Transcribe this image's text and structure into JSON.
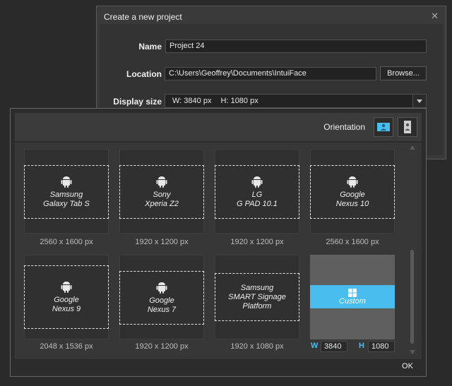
{
  "dialog": {
    "title": "Create a new project",
    "close_icon": "close-icon",
    "name_label": "Name",
    "name_value": "Project 24",
    "location_label": "Location",
    "location_value": "C:\\Users\\Geoffrey\\Documents\\IntuiFace",
    "browse_label": "Browse...",
    "display_size_label": "Display size",
    "display_size_w": "W:  3840 px",
    "display_size_h": "H:  1080 px"
  },
  "panel": {
    "orientation_label": "Orientation",
    "orientation_landscape_icon": "landscape-icon",
    "orientation_portrait_icon": "portrait-icon",
    "ok_label": "OK",
    "devices": [
      {
        "line1": "Samsung",
        "line2": "Galaxy Tab S",
        "size": "2560 x 1600 px"
      },
      {
        "line1": "Sony",
        "line2": "Xperia Z2",
        "size": "1920 x 1200 px"
      },
      {
        "line1": "LG",
        "line2": "G PAD 10.1",
        "size": "1920 x 1200 px"
      },
      {
        "line1": "Google",
        "line2": "Nexus 10",
        "size": "2560 x 1600 px"
      },
      {
        "line1": "Google",
        "line2": "Nexus 9",
        "size": "2048 x 1536 px"
      },
      {
        "line1": "Google",
        "line2": "Nexus 7",
        "size": "1920 x 1200 px"
      },
      {
        "line1": "Samsung",
        "line2": "SMART Signage",
        "line3": "Platform",
        "size": "1920 x 1080 px"
      }
    ],
    "custom": {
      "label": "Custom",
      "icon": "windows-icon",
      "w_label": "W",
      "w_value": "3840",
      "h_label": "H",
      "h_value": "1080"
    }
  },
  "colors": {
    "accent": "#49bdee",
    "background": "#2a2a2a"
  }
}
